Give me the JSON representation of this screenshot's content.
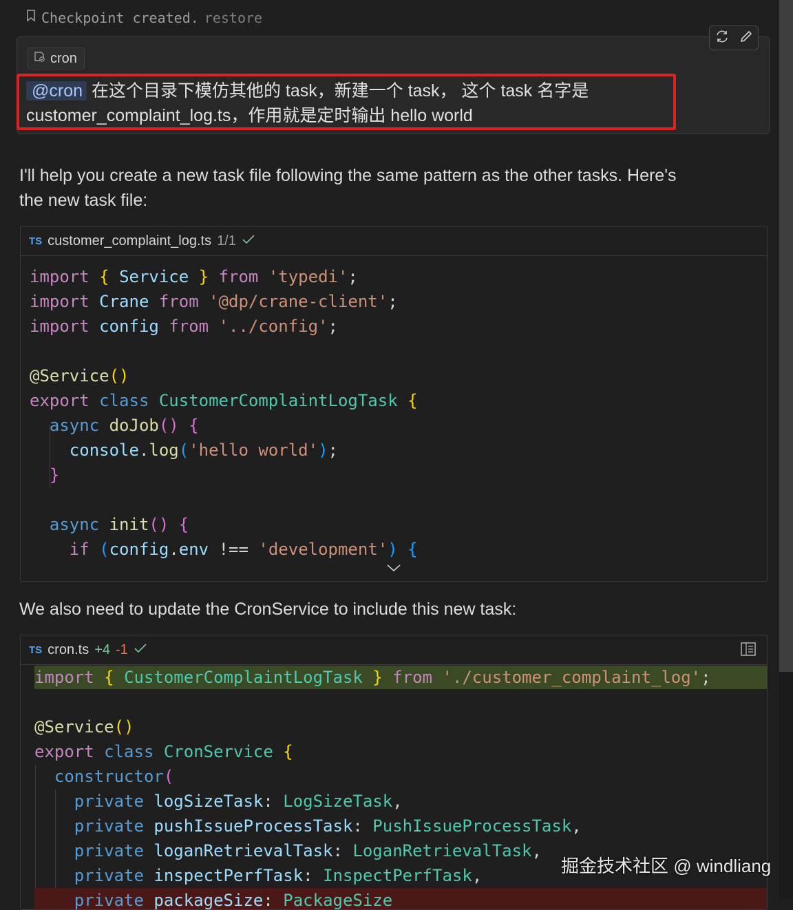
{
  "checkpoint": {
    "text": "Checkpoint created.",
    "restore_label": "restore"
  },
  "user_message": {
    "context_chip": "cron",
    "mention": "@cron",
    "line1": "在这个目录下模仿其他的 task，新建一个 task， 这个 task 名字是",
    "line2": "customer_complaint_log.ts，作用就是定时输出 hello world"
  },
  "assistant": {
    "intro_line1": "I'll help you create a new task file following the same pattern as the other tasks. Here's",
    "intro_line2": "the new task file:",
    "followup": "We also need to update the CronService to include this new task:"
  },
  "code_block_1": {
    "lang_badge": "TS",
    "filename": "customer_complaint_log.ts",
    "status": "1/1"
  },
  "code_block_2": {
    "lang_badge": "TS",
    "filename": "cron.ts",
    "added": "+4",
    "removed": "-1"
  },
  "icons": {
    "checkpoint": "bookmark-icon",
    "regenerate": "refresh-icon",
    "edit": "pencil-icon",
    "context_file": "file-icon",
    "applied": "check-icon",
    "expand": "chevron-down-icon",
    "open_in_editor": "panel-icon"
  },
  "colors": {
    "highlight_frame": "#dd2222",
    "added_line": "#3a4a24",
    "removed_line": "#4b1818"
  },
  "watermark": "掘金技术社区 @ windliang"
}
